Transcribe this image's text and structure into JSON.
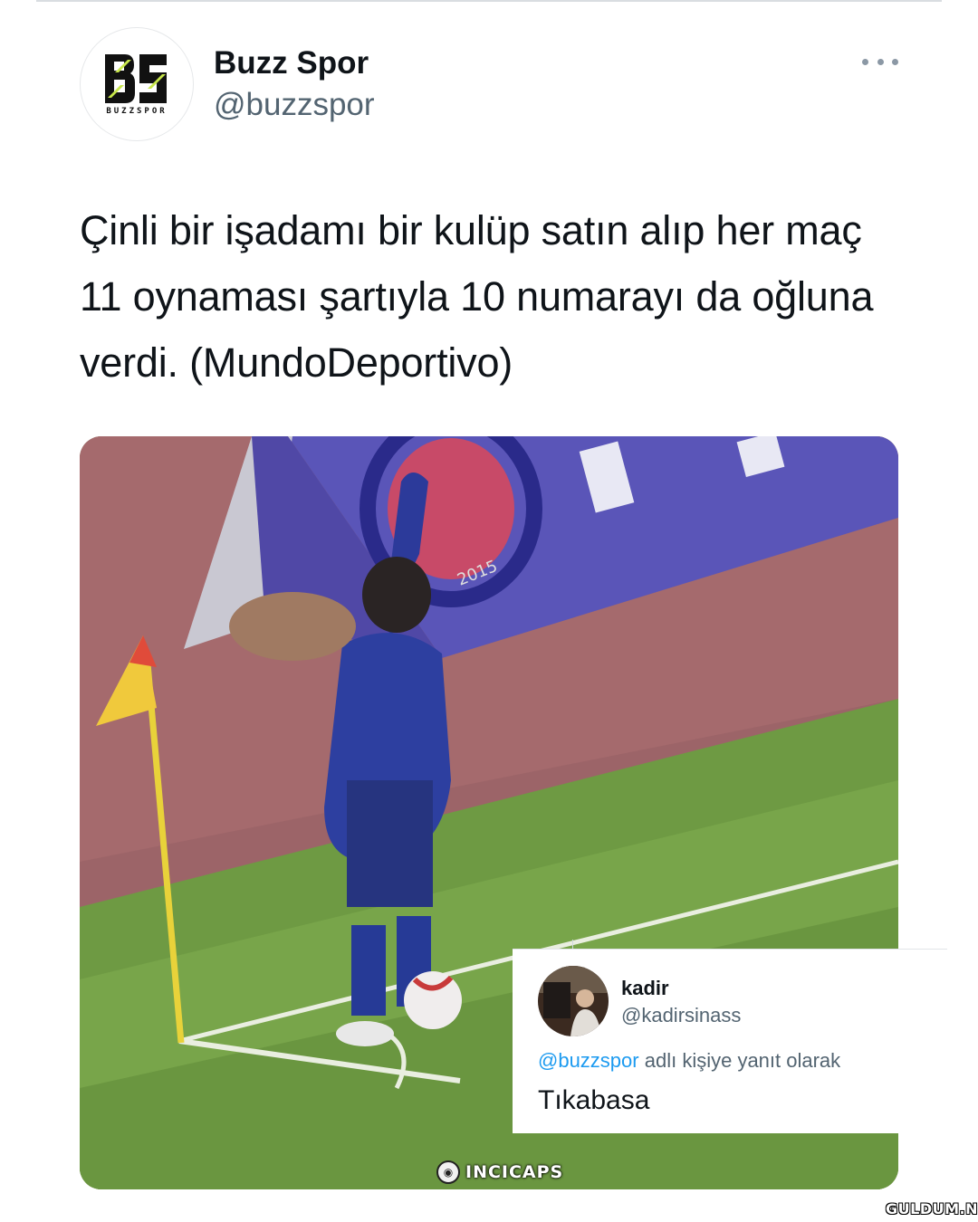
{
  "tweet": {
    "author_name": "Buzz Spor",
    "author_handle": "@buzzspor",
    "avatar_logo": "BS",
    "avatar_logo_sub": "BUZZSPOR",
    "text": "Çinli bir işadamı bir kulüp satın alıp her maç 11 oynaması şartıyla 10 numarayı da oğluna verdi. (MundoDeportivo)",
    "more_icon": "more-horizontal-icon"
  },
  "media": {
    "banner_year": "2015",
    "watermark": "INCICAPS"
  },
  "reply": {
    "author_name": "kadir",
    "author_handle": "@kadirsinass",
    "context_mention": "@buzzspor",
    "context_text": "adlı kişiye yanıt olarak",
    "text": "Tıkabasa"
  },
  "site_watermark": "GULDUM.NET",
  "colors": {
    "accent": "#1d9bf0",
    "secondary_text": "#536471",
    "logo_green": "#c7e64a"
  }
}
